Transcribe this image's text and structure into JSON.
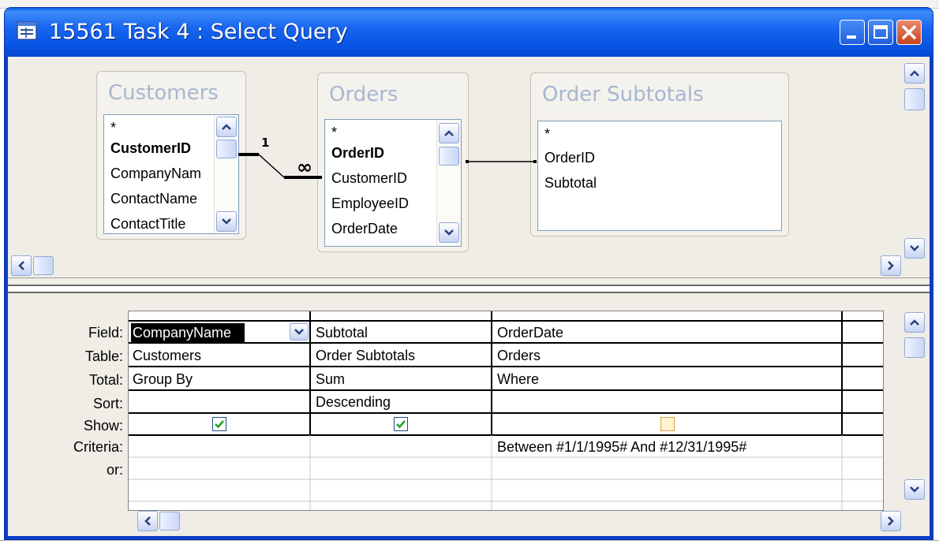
{
  "window": {
    "title": "15561 Task 4 : Select Query"
  },
  "tables": [
    {
      "name": "Customers",
      "fields": [
        "*",
        "CustomerID",
        "CompanyNam",
        "ContactName",
        "ContactTitle"
      ]
    },
    {
      "name": "Orders",
      "fields": [
        "*",
        "OrderID",
        "CustomerID",
        "EmployeeID",
        "OrderDate"
      ]
    },
    {
      "name": "Order Subtotals",
      "fields": [
        "*",
        "OrderID",
        "Subtotal"
      ]
    }
  ],
  "relationship": {
    "one_label": "1",
    "many_label": "∞"
  },
  "grid": {
    "row_labels": [
      "Field:",
      "Table:",
      "Total:",
      "Sort:",
      "Show:",
      "Criteria:",
      "or:"
    ],
    "columns": [
      {
        "field": "CompanyName",
        "table": "Customers",
        "total": "Group By",
        "sort": "",
        "show": true,
        "criteria": ""
      },
      {
        "field": "Subtotal",
        "table": "Order Subtotals",
        "total": "Sum",
        "sort": "Descending",
        "show": true,
        "criteria": ""
      },
      {
        "field": "OrderDate",
        "table": "Orders",
        "total": "Where",
        "sort": "",
        "show": false,
        "criteria": "Between #1/1/1995# And #12/31/1995#"
      }
    ]
  },
  "colors": {
    "title_blue": "#0755e4",
    "check_green": "#21a121",
    "table_title": "#a7b7d2"
  }
}
